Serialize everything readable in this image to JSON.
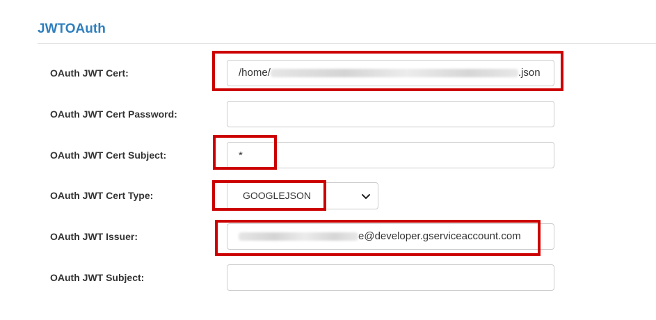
{
  "section": {
    "title": "JWTOAuth"
  },
  "fields": {
    "cert": {
      "label": "OAuth JWT Cert:",
      "value_prefix": "/home/",
      "value_suffix": ".json"
    },
    "cert_password": {
      "label": "OAuth JWT Cert Password:",
      "value": ""
    },
    "cert_subject": {
      "label": "OAuth JWT Cert Subject:",
      "value": "*"
    },
    "cert_type": {
      "label": "OAuth JWT Cert Type:",
      "selected": "GOOGLEJSON"
    },
    "issuer": {
      "label": "OAuth JWT Issuer:",
      "value_suffix": "e@developer.gserviceaccount.com"
    },
    "subject": {
      "label": "OAuth JWT Subject:",
      "value": ""
    }
  },
  "colors": {
    "title": "#2f7fbd",
    "highlight": "#cc0000",
    "input_border": "#cccccc"
  },
  "icons": {
    "select_arrow": "chevron-down-icon"
  }
}
